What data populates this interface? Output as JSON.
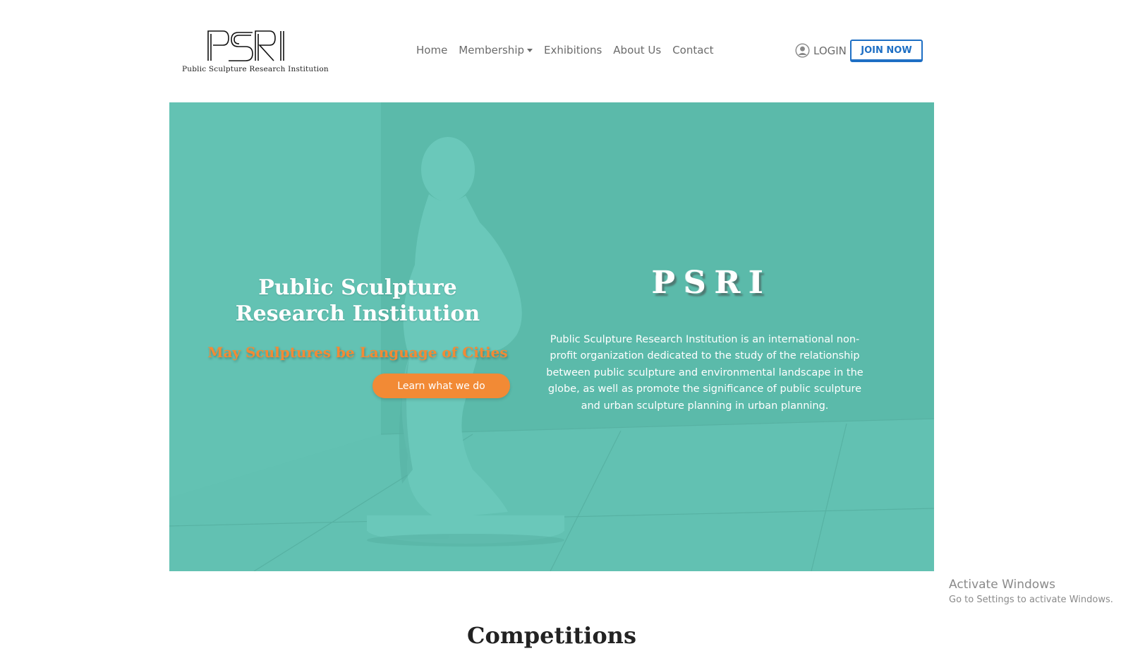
{
  "header": {
    "logo": {
      "mark": "PSRI",
      "tagline": "Public Sculpture Research Institution"
    },
    "nav": [
      {
        "label": "Home"
      },
      {
        "label": "Membership",
        "has_dropdown": true
      },
      {
        "label": "Exhibitions"
      },
      {
        "label": "About Us"
      },
      {
        "label": "Contact"
      }
    ],
    "login_label": "LOGIN",
    "join_label": "JOIN NOW"
  },
  "hero": {
    "title_line1": "Public Sculpture",
    "title_line2": "Research Institution",
    "tagline": "May Sculptures be Language of Cities",
    "button_label": "Learn what we do",
    "mark": "PSRI",
    "description": "Public Sculpture Research Institution is an international non-profit organization dedicated to the study of the relationship between public sculpture and environmental landscape in the globe, as well as promote the significance of public sculpture and urban sculpture planning in urban planning."
  },
  "section": {
    "title": "Competitions"
  },
  "windows_watermark": {
    "line1": "Activate Windows",
    "line2": "Go to Settings to activate Windows."
  },
  "colors": {
    "hero_bg": "#5fbfb0",
    "accent_orange": "#f28a35",
    "join_blue": "#1e6fc4",
    "nav_text": "#6b6b6b"
  }
}
